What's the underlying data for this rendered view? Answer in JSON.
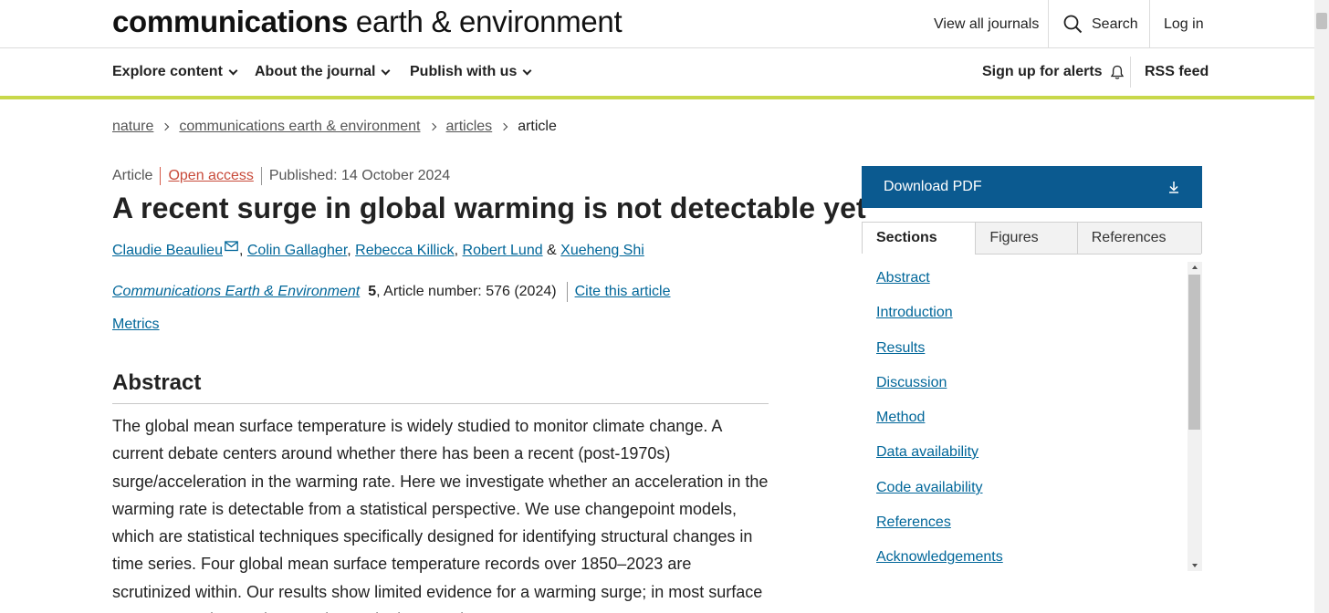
{
  "header": {
    "brand_bold": "communications",
    "brand_light": "earth & environment",
    "view_all_journals": "View all journals",
    "search_label": "Search",
    "login_label": "Log in"
  },
  "nav": {
    "explore": "Explore content",
    "about": "About the journal",
    "publish": "Publish with us",
    "alerts": "Sign up for alerts",
    "rss": "RSS feed"
  },
  "breadcrumb": {
    "items": [
      "nature",
      "communications earth & environment",
      "articles"
    ],
    "current": "article"
  },
  "article": {
    "type": "Article",
    "access": "Open access",
    "published": "Published: 14 October 2024",
    "title": "A recent surge in global warming is not detectable yet",
    "authors": [
      "Claudie Beaulieu",
      "Colin Gallagher",
      "Rebecca Killick",
      "Robert Lund",
      "Xueheng Shi"
    ],
    "author_sep": ", ",
    "author_last_sep": " & ",
    "journal": "Communications Earth & Environment",
    "volume": "5",
    "article_number": ", Article number: 576 (2024)",
    "cite": "Cite this article",
    "metrics": "Metrics"
  },
  "abstract": {
    "heading": "Abstract",
    "text": "The global mean surface temperature is widely studied to monitor climate change. A current debate centers around whether there has been a recent (post-1970s) surge/acceleration in the warming rate. Here we investigate whether an acceleration in the warming rate is detectable from a statistical perspective. We use changepoint models, which are statistical techniques specifically designed for identifying structural changes in time series. Four global mean surface temperature records over 1850–2023 are scrutinized within. Our results show limited evidence for a warming surge; in most surface temperature time series, no change in the warming rate"
  },
  "sidebar": {
    "download_pdf": "Download PDF",
    "tabs": [
      "Sections",
      "Figures",
      "References"
    ],
    "sections": [
      "Abstract",
      "Introduction",
      "Results",
      "Discussion",
      "Method",
      "Data availability",
      "Code availability",
      "References",
      "Acknowledgements"
    ]
  },
  "colors": {
    "accent": "#c8d84a",
    "link": "#006699",
    "download_button": "#0b5a90",
    "open_access": "#c84a3a"
  }
}
